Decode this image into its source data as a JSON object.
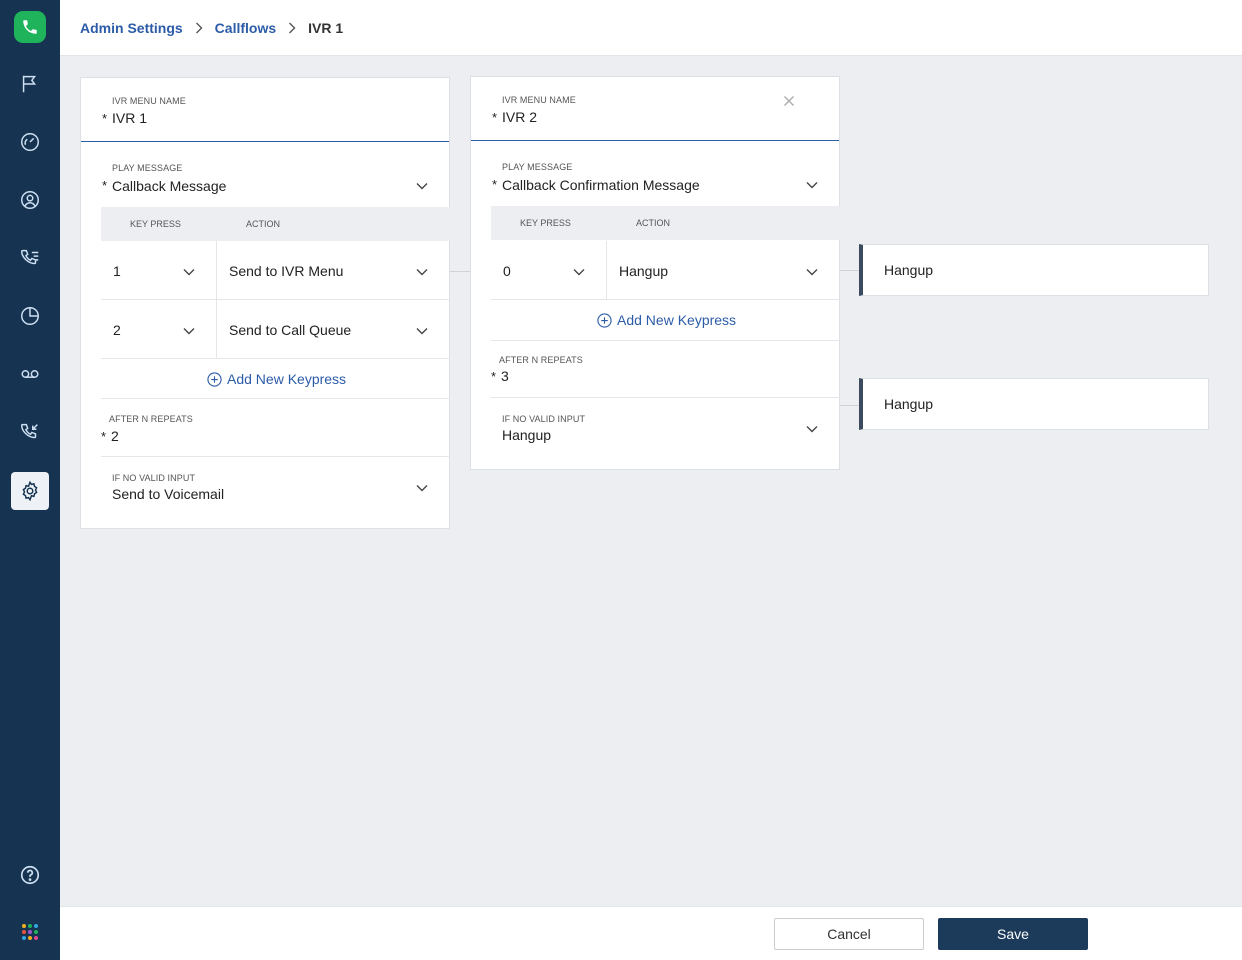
{
  "breadcrumb": {
    "items": [
      "Admin Settings",
      "Callflows"
    ],
    "current": "IVR 1"
  },
  "ivr1": {
    "name_label": "IVR MENU NAME",
    "name_value": "IVR 1",
    "play_label": "PLAY MESSAGE",
    "play_value": "Callback Message",
    "col_key": "KEY PRESS",
    "col_action": "ACTION",
    "rows": [
      {
        "key": "1",
        "action": "Send to IVR Menu"
      },
      {
        "key": "2",
        "action": "Send to Call Queue"
      }
    ],
    "add_keypress": "Add New Keypress",
    "repeats_label": "AFTER N REPEATS",
    "repeats_value": "2",
    "novalid_label": "IF NO VALID INPUT",
    "novalid_value": "Send to Voicemail"
  },
  "ivr2": {
    "name_label": "IVR MENU NAME",
    "name_value": "IVR 2",
    "play_label": "PLAY MESSAGE",
    "play_value": "Callback Confirmation Message",
    "col_key": "KEY PRESS",
    "col_action": "ACTION",
    "rows": [
      {
        "key": "0",
        "action": "Hangup"
      }
    ],
    "add_keypress": "Add New Keypress",
    "repeats_label": "AFTER N REPEATS",
    "repeats_value": "3",
    "novalid_label": "IF NO VALID INPUT",
    "novalid_value": "Hangup"
  },
  "results": [
    "Hangup",
    "Hangup"
  ],
  "required_mark": "*",
  "footer": {
    "cancel_label": "Cancel",
    "save_label": "Save"
  },
  "colors": {
    "sidebar": "#163452",
    "accent": "#2c5ca8",
    "logo": "#1fb35b",
    "save": "#1c3a5a"
  },
  "icons": {
    "sidebar": [
      "phone-logo-icon",
      "flag-icon",
      "gauge-icon",
      "user-circle-icon",
      "call-list-icon",
      "pie-chart-icon",
      "voicemail-icon",
      "phone-incoming-icon",
      "gear-icon",
      "help-icon",
      "app-grid-icon"
    ]
  }
}
